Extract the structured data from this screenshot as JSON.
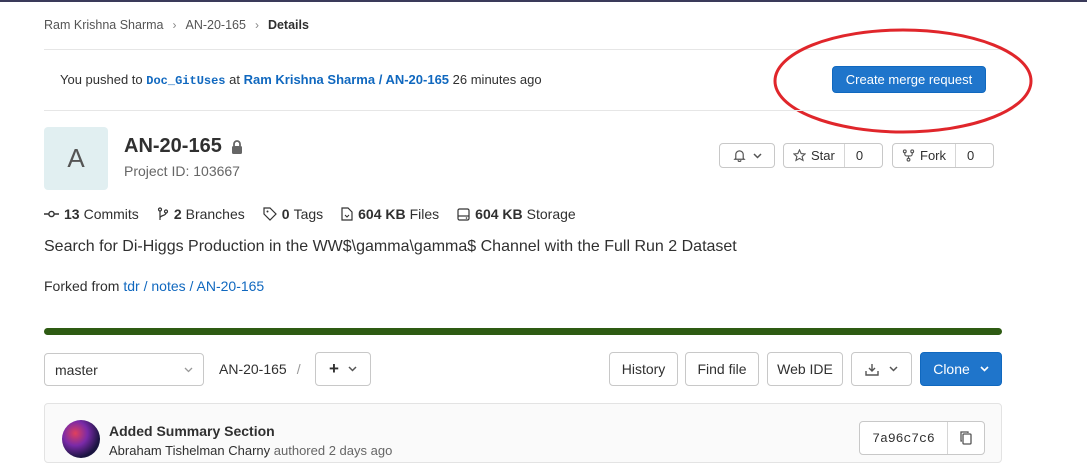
{
  "breadcrumb": {
    "items": [
      "Ram Krishna Sharma",
      "AN-20-165"
    ],
    "current": "Details"
  },
  "push_banner": {
    "prefix": "You pushed to",
    "branch": "Doc_GitUses",
    "at": "at",
    "project_link": "Ram Krishna Sharma / AN-20-165",
    "time": "26 minutes ago",
    "button_label": "Create merge request"
  },
  "project": {
    "avatar_letter": "A",
    "name": "AN-20-165",
    "id_text": "Project ID: 103667",
    "star_label": "Star",
    "star_count": "0",
    "fork_label": "Fork",
    "fork_count": "0"
  },
  "stats": {
    "commits_count": "13",
    "commits_label": "Commits",
    "branches_count": "2",
    "branches_label": "Branches",
    "tags_count": "0",
    "tags_label": "Tags",
    "files_size": "604 KB",
    "files_label": "Files",
    "storage_size": "604 KB",
    "storage_label": "Storage"
  },
  "description": "Search for Di-Higgs Production in the WW$\\gamma\\gamma$ Channel with the Full Run 2 Dataset",
  "forked": {
    "prefix": "Forked from",
    "link": "tdr / notes / AN-20-165"
  },
  "language_bar": {
    "fraction": 1.0,
    "color": "#2e5b13"
  },
  "toolbar": {
    "branch_select": "master",
    "path": "AN-20-165",
    "path_sep": "/",
    "add_label": "+",
    "history": "History",
    "find_file": "Find file",
    "web_ide": "Web IDE",
    "clone": "Clone"
  },
  "commit": {
    "title": "Added Summary Section",
    "author": "Abraham Tishelman Charny",
    "meta": "authored 2 days ago",
    "sha": "7a96c7c6"
  },
  "colors": {
    "accent": "#1f75cb",
    "annotation": "#e0262b"
  }
}
